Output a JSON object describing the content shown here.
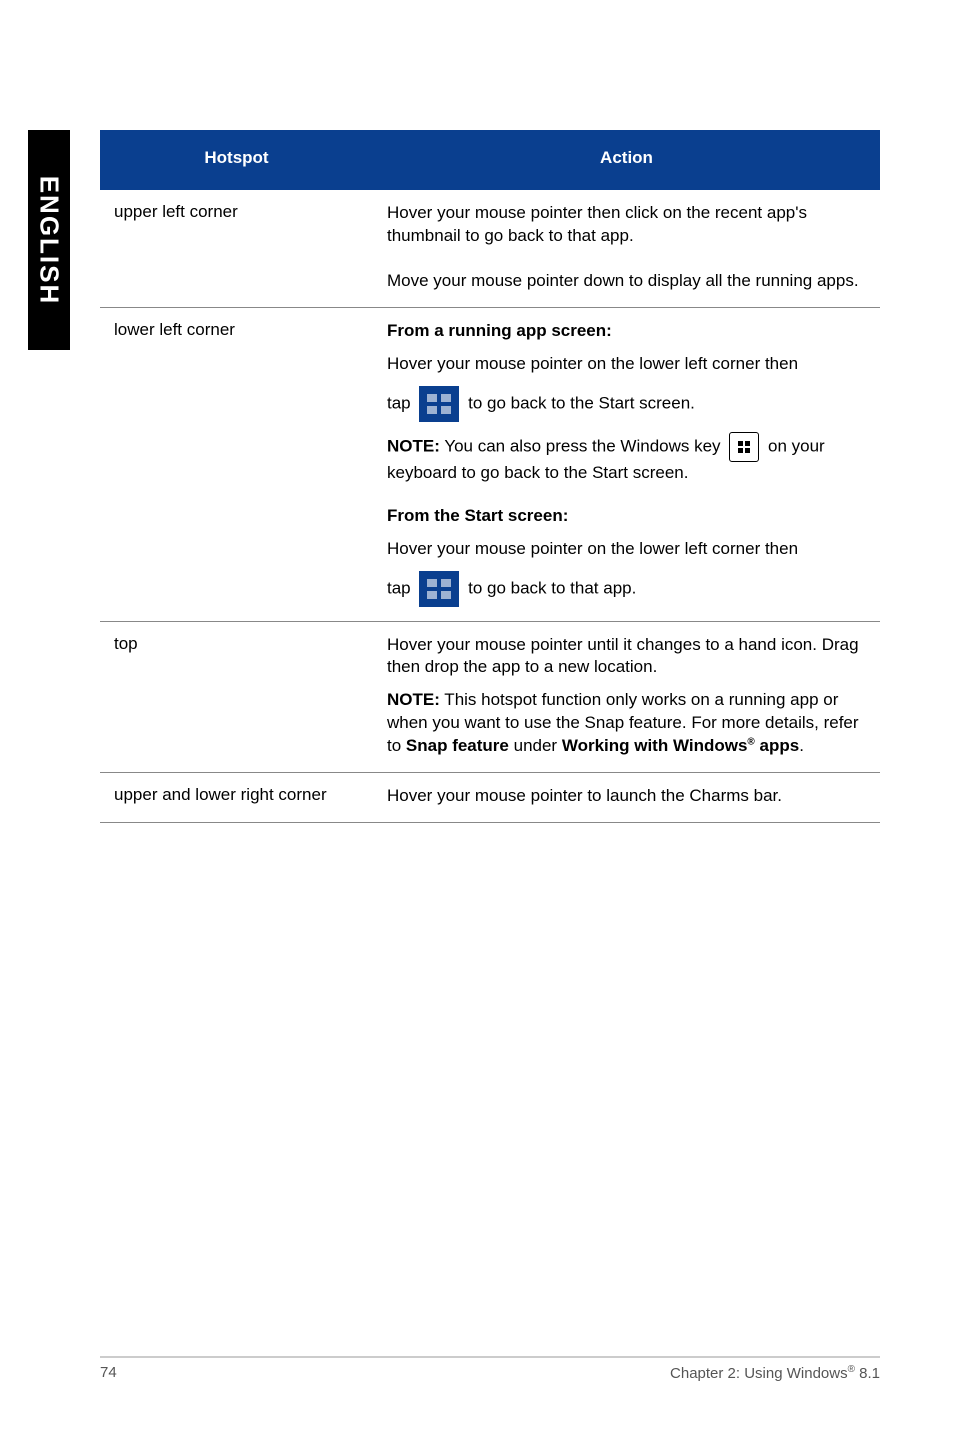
{
  "side_tab": "ENGLISH",
  "table": {
    "headers": {
      "hotspot": "Hotspot",
      "action": "Action"
    },
    "rows": {
      "r1": {
        "hotspot": "upper left corner",
        "p1": "Hover your mouse pointer then click on the recent app's thumbnail to go back to that app.",
        "p2": "Move your mouse pointer down to display all the running apps."
      },
      "r2": {
        "hotspot": "lower left corner",
        "h1": "From a running app screen:",
        "p1": "Hover your mouse pointer on the lower left corner then",
        "tap1a": "tap ",
        "tap1b": " to go back to the Start screen.",
        "note_label": "NOTE:",
        "note_body_a": "  You can also press the Windows key ",
        "note_body_b": " on your keyboard to go back to the Start screen.",
        "h2": "From the Start screen:",
        "p2": "Hover your mouse pointer on the lower left corner then",
        "tap2a": "tap ",
        "tap2b": " to go back to that app."
      },
      "r3": {
        "hotspot": "top",
        "p1": "Hover your mouse pointer until it changes to a hand icon. Drag then drop the app to a new location.",
        "note_label": "NOTE:",
        "note_body_a": "  This hotspot function only works on a running app or when you want to use the Snap feature. For more details, refer to ",
        "bold1": "Snap feature",
        "mid": " under ",
        "bold2": "Working with Windows",
        "sup": "®",
        "bold3": " apps",
        "tail": "."
      },
      "r4": {
        "hotspot": "upper and lower right corner",
        "p1": "Hover your mouse pointer to launch the Charms bar."
      }
    }
  },
  "footer": {
    "page": "74",
    "chapter_a": "Chapter 2: Using Windows",
    "chapter_sup": "®",
    "chapter_b": " 8.1"
  }
}
